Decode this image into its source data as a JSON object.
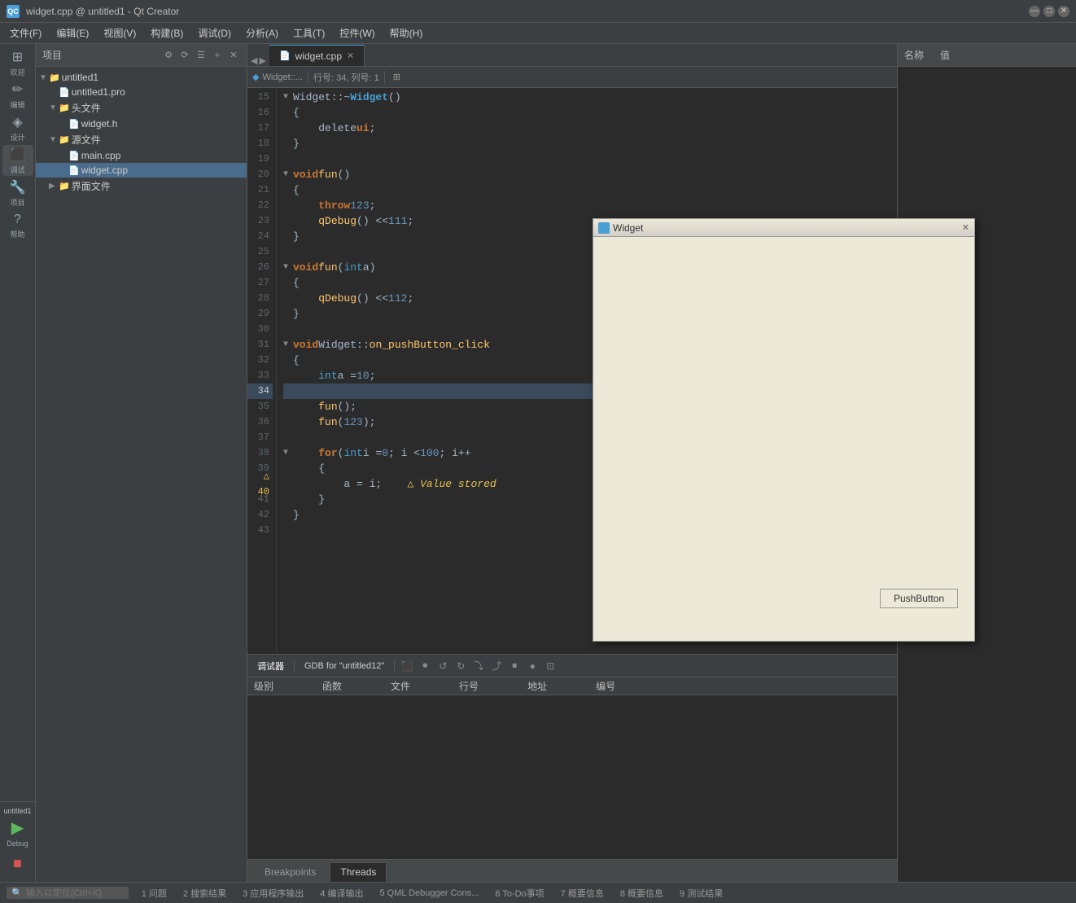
{
  "titlebar": {
    "app_icon": "QC",
    "title": "widget.cpp @ untitled1 - Qt Creator",
    "minimize": "—",
    "maximize": "□",
    "close": "✕"
  },
  "menubar": {
    "items": [
      "文件(F)",
      "编辑(E)",
      "视图(V)",
      "构建(B)",
      "调试(D)",
      "分析(A)",
      "工具(T)",
      "控件(W)",
      "帮助(H)"
    ]
  },
  "sidebar": {
    "items": [
      {
        "id": "welcome",
        "icon": "⊞",
        "label": "欢迎"
      },
      {
        "id": "edit",
        "icon": "✎",
        "label": "编辑"
      },
      {
        "id": "design",
        "icon": "◈",
        "label": "设计"
      },
      {
        "id": "debug",
        "icon": "⬛",
        "label": "调试"
      },
      {
        "id": "project",
        "icon": "🔧",
        "label": "项目"
      },
      {
        "id": "help",
        "icon": "?",
        "label": "帮助"
      }
    ],
    "bottom_items": [
      {
        "id": "untitled1",
        "label": "untitled1"
      },
      {
        "id": "debug-mode",
        "icon": "▶",
        "label": "Debug"
      }
    ]
  },
  "project_panel": {
    "title": "项目",
    "tree": [
      {
        "id": "root",
        "level": 0,
        "icon": "▼",
        "type": "project",
        "label": "untitled1",
        "has_arrow": true
      },
      {
        "id": "pro-file",
        "level": 1,
        "icon": "📄",
        "type": "file-pro",
        "label": "untitled1.pro",
        "has_arrow": false
      },
      {
        "id": "headers",
        "level": 1,
        "icon": "▼",
        "type": "folder",
        "label": "头文件",
        "has_arrow": true
      },
      {
        "id": "widget-h",
        "level": 2,
        "icon": "📄",
        "type": "file-h",
        "label": "widget.h",
        "has_arrow": false
      },
      {
        "id": "sources",
        "level": 1,
        "icon": "▼",
        "type": "folder",
        "label": "源文件",
        "has_arrow": true
      },
      {
        "id": "main-cpp",
        "level": 2,
        "icon": "📄",
        "type": "file-cpp",
        "label": "main.cpp",
        "has_arrow": false
      },
      {
        "id": "widget-cpp",
        "level": 2,
        "icon": "📄",
        "type": "file-cpp",
        "label": "widget.cpp",
        "has_arrow": false,
        "selected": true
      },
      {
        "id": "ui-files",
        "level": 1,
        "icon": "▶",
        "type": "folder",
        "label": "界面文件",
        "has_arrow": true
      }
    ]
  },
  "editor": {
    "tab_label": "widget.cpp",
    "tab_secondary": "Widget::...",
    "position_label": "行号: 34, 列号: 1",
    "code_lines": [
      {
        "num": 15,
        "content": "Widget::~<b>Widget</b>()",
        "has_fold": true
      },
      {
        "num": 16,
        "content": "{"
      },
      {
        "num": 17,
        "content": "    <span class='plain'>delete</span> <span class='kw'>ui</span>;"
      },
      {
        "num": 18,
        "content": "}"
      },
      {
        "num": 19,
        "content": ""
      },
      {
        "num": 20,
        "content": "<span class='kw'>void</span> <span class='fn'>fun</span>()",
        "has_fold": true
      },
      {
        "num": 21,
        "content": "{"
      },
      {
        "num": 22,
        "content": "    <span class='kw'>throw</span> <span class='num'>123</span>;"
      },
      {
        "num": 23,
        "content": "    <span class='fn'>qDebug</span>() << <span class='num'>111</span>;"
      },
      {
        "num": 24,
        "content": "}"
      },
      {
        "num": 25,
        "content": ""
      },
      {
        "num": 26,
        "content": "<span class='kw'>void</span> <span class='fn'>fun</span>(<span class='type'>int</span> a)",
        "has_fold": true
      },
      {
        "num": 27,
        "content": "{"
      },
      {
        "num": 28,
        "content": "    <span class='fn'>qDebug</span>() << <span class='num'>112</span>;"
      },
      {
        "num": 29,
        "content": "}"
      },
      {
        "num": 30,
        "content": ""
      },
      {
        "num": 31,
        "content": "<span class='kw'>void</span> Widget::<span class='fn'>on_pushButton_click</span>",
        "has_fold": true
      },
      {
        "num": 32,
        "content": "{"
      },
      {
        "num": 33,
        "content": "    <span class='type'>int</span> a = <span class='num'>10</span>;"
      },
      {
        "num": 34,
        "content": "",
        "highlighted": true
      },
      {
        "num": 35,
        "content": "    <span class='fn'>fun</span>();"
      },
      {
        "num": 36,
        "content": "    <span class='fn'>fun</span>(<span class='num'>123</span>);"
      },
      {
        "num": 37,
        "content": ""
      },
      {
        "num": 38,
        "content": "    <span class='kw'>for</span> (<span class='type'>int</span> i = <span class='num'>0</span>; i < <span class='num'>100</span>; i++",
        "has_fold": true
      },
      {
        "num": 39,
        "content": "    {"
      },
      {
        "num": 40,
        "content": "        a = i;    <span class='warn-text'>△ Value stored</span>",
        "warning": true
      },
      {
        "num": 41,
        "content": "    }"
      },
      {
        "num": 42,
        "content": "}"
      },
      {
        "num": 43,
        "content": ""
      }
    ]
  },
  "properties_panel": {
    "name_header": "名称",
    "value_header": "值"
  },
  "bottom_panel": {
    "toolbar_label": "调试器",
    "gdb_label": "GDB for \"untitled12\"",
    "table_columns": [
      "级别",
      "函数",
      "文件",
      "行号",
      "地址",
      "编号"
    ],
    "tabs": [
      {
        "id": "breakpoints",
        "label": "Breakpoints"
      },
      {
        "id": "threads",
        "label": "Threads"
      }
    ]
  },
  "status_bar": {
    "items": [
      "1 问题",
      "2 搜索结果",
      "3 应用程序输出",
      "4 编译输出",
      "5 QML Debugger Cons...",
      "6 To-Do事项",
      "7 概要信息",
      "8 概要信息",
      "9 测试结果"
    ],
    "search_placeholder": "输入以定位(Ctrl+K)"
  },
  "widget_window": {
    "title": "Widget",
    "pushbutton_label": "PushButton"
  },
  "debug_left": {
    "project_label": "untitled1",
    "debug_label": "Debug",
    "run_icon": "▶",
    "stop_icon": "■"
  }
}
